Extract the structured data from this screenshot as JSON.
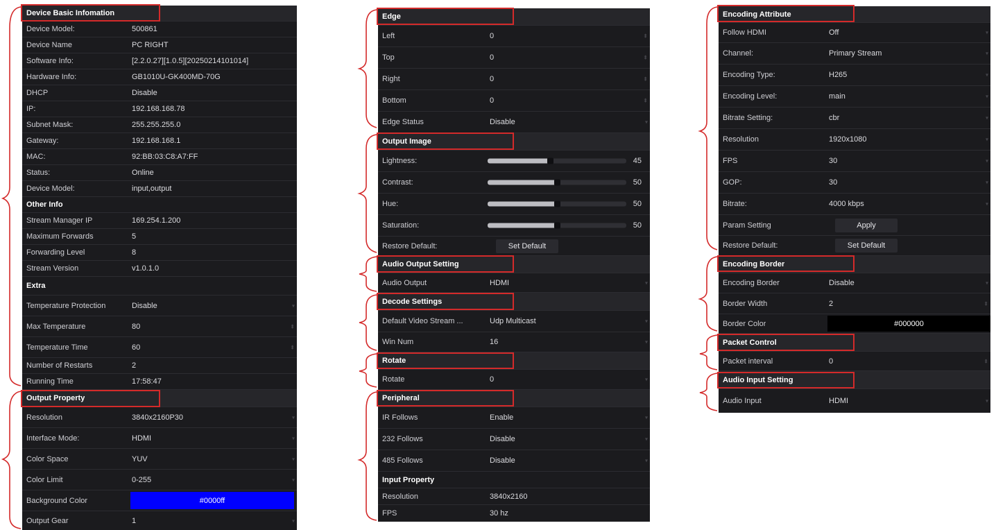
{
  "col1": {
    "section_device": "Device Basic Infomation",
    "device_rows": [
      {
        "label": "Device Model:",
        "value": "500861"
      },
      {
        "label": "Device Name",
        "value": "PC RIGHT"
      },
      {
        "label": "Software Info:",
        "value": "[2.2.0.27][1.0.5][20250214101014]"
      },
      {
        "label": "Hardware Info:",
        "value": "GB1010U-GK400MD-70G"
      },
      {
        "label": "DHCP",
        "value": "Disable"
      },
      {
        "label": "IP:",
        "value": "192.168.168.78"
      },
      {
        "label": "Subnet Mask:",
        "value": "255.255.255.0"
      },
      {
        "label": "Gateway:",
        "value": "192.168.168.1"
      },
      {
        "label": "MAC:",
        "value": "92:BB:03:C8:A7:FF"
      },
      {
        "label": "Status:",
        "value": "Online"
      },
      {
        "label": "Device Model:",
        "value": "input,output"
      }
    ],
    "other_info_title": "Other Info",
    "other_rows": [
      {
        "label": "Stream Manager IP",
        "value": "169.254.1.200"
      },
      {
        "label": "Maximum Forwards",
        "value": "5"
      },
      {
        "label": "Forwarding Level",
        "value": "8"
      },
      {
        "label": "Stream Version",
        "value": "v1.0.1.0"
      }
    ],
    "extra_title": "Extra",
    "extra_rows": [
      {
        "label": "Temperature Protection",
        "value": "Disable"
      },
      {
        "label": "Max Temperature",
        "value": "80"
      },
      {
        "label": "Temperature Time",
        "value": "60"
      },
      {
        "label": "Number of Restarts",
        "value": "2"
      },
      {
        "label": "Running Time",
        "value": "17:58:47"
      }
    ],
    "section_output": "Output Property",
    "output_rows": [
      {
        "label": "Resolution",
        "value": "3840x2160P30"
      },
      {
        "label": "Interface Mode:",
        "value": "HDMI"
      },
      {
        "label": "Color Space",
        "value": "YUV"
      },
      {
        "label": "Color Limit",
        "value": "0-255"
      }
    ],
    "background_color_label": "Background Color",
    "background_color_value": "#0000ff",
    "output_gear_label": "Output Gear",
    "output_gear_value": "1"
  },
  "col2": {
    "section_edge": "Edge",
    "edge_rows": [
      {
        "label": "Left",
        "value": "0"
      },
      {
        "label": "Top",
        "value": "0"
      },
      {
        "label": "Right",
        "value": "0"
      },
      {
        "label": "Bottom",
        "value": "0"
      },
      {
        "label": "Edge Status",
        "value": "Disable"
      }
    ],
    "section_output_image": "Output Image",
    "sliders": [
      {
        "label": "Lightness:",
        "value": "45",
        "fraction": 0.45
      },
      {
        "label": "Contrast:",
        "value": "50",
        "fraction": 0.5
      },
      {
        "label": "Hue:",
        "value": "50",
        "fraction": 0.5
      },
      {
        "label": "Saturation:",
        "value": "50",
        "fraction": 0.5
      }
    ],
    "restore_default_label": "Restore Default:",
    "set_default_button": "Set Default",
    "section_audio_output": "Audio Output Setting",
    "audio_output_label": "Audio Output",
    "audio_output_value": "HDMI",
    "section_decode": "Decode Settings",
    "default_video_stream_label": "Default Video Stream ...",
    "default_video_stream_value": "Udp Multicast",
    "win_num_label": "Win Num",
    "win_num_value": "16",
    "section_rotate": "Rotate",
    "rotate_label": "Rotate",
    "rotate_value": "0",
    "section_peripheral": "Peripheral",
    "peripheral_rows": [
      {
        "label": "IR Follows",
        "value": "Enable"
      },
      {
        "label": "232 Follows",
        "value": "Disable"
      },
      {
        "label": "485 Follows",
        "value": "Disable"
      }
    ],
    "input_property_title": "Input Property",
    "input_rows": [
      {
        "label": "Resolution",
        "value": "3840x2160"
      },
      {
        "label": "FPS",
        "value": "30 hz"
      }
    ]
  },
  "col3": {
    "section_encoding_attr": "Encoding Attribute",
    "encoding_rows": [
      {
        "label": "Follow HDMI",
        "value": "Off"
      },
      {
        "label": "Channel:",
        "value": "Primary Stream"
      },
      {
        "label": "Encoding Type:",
        "value": "H265"
      },
      {
        "label": "Encoding Level:",
        "value": "main"
      },
      {
        "label": "Bitrate Setting:",
        "value": "cbr"
      },
      {
        "label": "Resolution",
        "value": "1920x1080"
      },
      {
        "label": "FPS",
        "value": "30"
      },
      {
        "label": "GOP:",
        "value": "30"
      },
      {
        "label": "Bitrate:",
        "value": "4000 kbps"
      }
    ],
    "param_setting_label": "Param Setting",
    "apply_button": "Apply",
    "restore_default_label": "Restore Default:",
    "set_default_button": "Set Default",
    "section_encoding_border": "Encoding Border",
    "encoding_border_label": "Encoding Border",
    "encoding_border_value": "Disable",
    "border_width_label": "Border Width",
    "border_width_value": "2",
    "border_color_label": "Border Color",
    "border_color_value": "#000000",
    "section_packet": "Packet Control",
    "packet_interval_label": "Packet interval",
    "packet_interval_value": "0",
    "section_audio_input": "Audio Input Setting",
    "audio_input_label": "Audio Input",
    "audio_input_value": "HDMI"
  },
  "colors": {
    "annotation": "#d42a2a",
    "panel": "#1b1b1e",
    "accent_blue": "#0000ff"
  }
}
